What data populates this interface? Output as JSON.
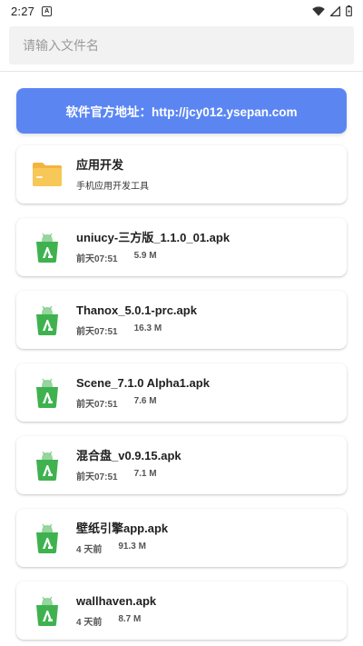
{
  "status_bar": {
    "time": "2:27",
    "notification_letter": "A"
  },
  "search": {
    "placeholder": "请输入文件名",
    "value": ""
  },
  "banner": {
    "text": "软件官方地址：http://jcy012.ysepan.com"
  },
  "folder": {
    "name": "应用开发",
    "description": "手机应用开发工具",
    "icon": "folder-icon"
  },
  "files": [
    {
      "name": "uniucy-三方版_1.1.0_01.apk",
      "date": "前天07:51",
      "size": "5.9 M",
      "icon": "apk-icon"
    },
    {
      "name": "Thanox_5.0.1-prc.apk",
      "date": "前天07:51",
      "size": "16.3 M",
      "icon": "apk-icon"
    },
    {
      "name": "Scene_7.1.0 Alpha1.apk",
      "date": "前天07:51",
      "size": "7.6 M",
      "icon": "apk-icon"
    },
    {
      "name": "混合盘_v0.9.15.apk",
      "date": "前天07:51",
      "size": "7.1 M",
      "icon": "apk-icon"
    },
    {
      "name": "壁纸引擎app.apk",
      "date": "4 天前",
      "size": "91.3 M",
      "icon": "apk-icon"
    },
    {
      "name": "wallhaven.apk",
      "date": "4 天前",
      "size": "8.7 M",
      "icon": "apk-icon"
    }
  ],
  "colors": {
    "banner": "#5b86f2",
    "apk_green": "#3fb24f",
    "folder_yellow": "#f7c857"
  }
}
